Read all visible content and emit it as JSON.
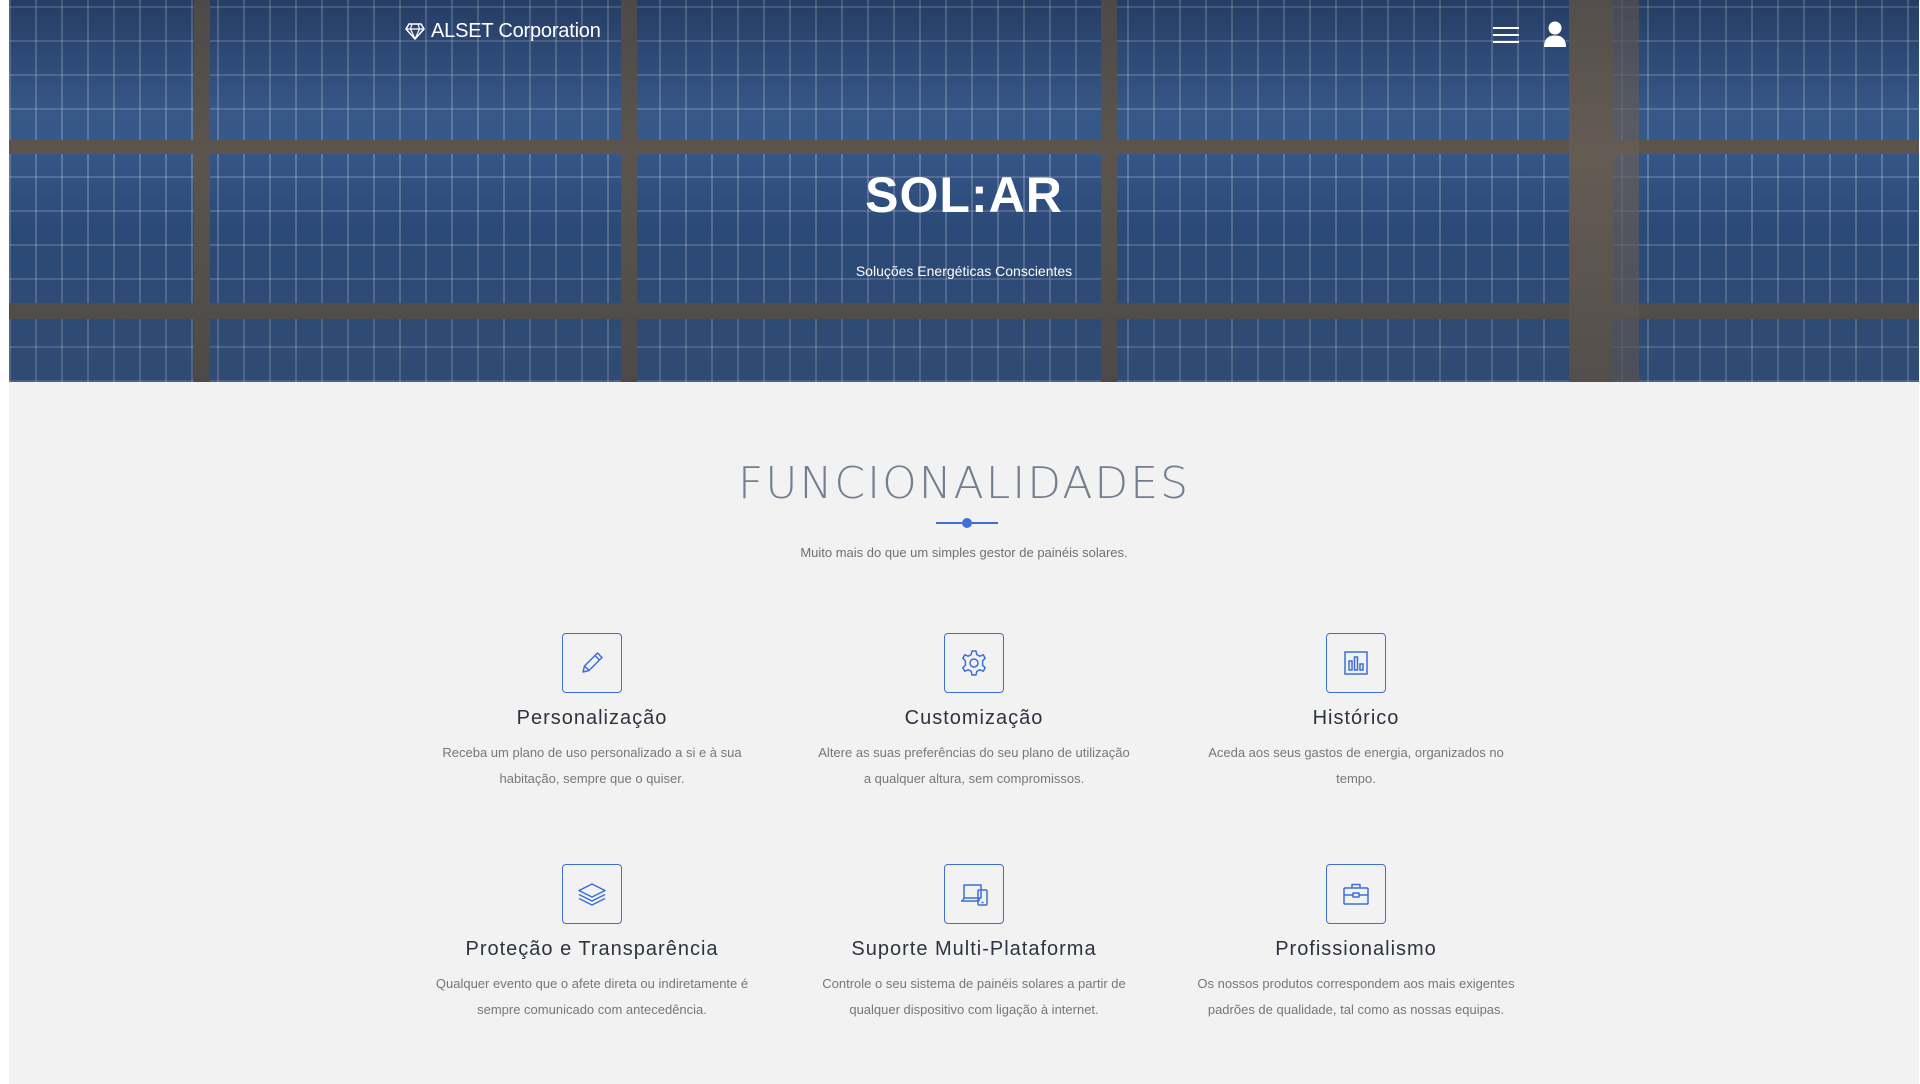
{
  "header": {
    "brand": "ALSET Corporation",
    "brand_icon": "diamond-icon",
    "menu_icon": "hamburger-menu-icon",
    "user_icon": "user-icon"
  },
  "hero": {
    "title": "SOL:AR",
    "subtitle": "Soluções Energéticas Conscientes"
  },
  "features_section": {
    "title": "FUNCIONALIDADES",
    "subtitle": "Muito mais do que um simples gestor de painéis solares.",
    "accent_color": "#3d6fd6",
    "items": [
      {
        "icon": "pencil-icon",
        "title": "Personalização",
        "description": "Receba um plano de uso personalizado a si e à sua habitação, sempre que o quiser."
      },
      {
        "icon": "gear-icon",
        "title": "Customização",
        "description": "Altere as suas preferências do seu plano de utilização a qualquer altura, sem compromissos."
      },
      {
        "icon": "bar-chart-icon",
        "title": "Histórico",
        "description": "Aceda aos seus gastos de energia, organizados no tempo."
      },
      {
        "icon": "layers-icon",
        "title": "Proteção e Transparência",
        "description": "Qualquer evento que o afete direta ou indiretamente é sempre comunicado com antecedência."
      },
      {
        "icon": "devices-icon",
        "title": "Suporte Multi-Plataforma",
        "description": "Controle o seu sistema de painéis solares a partir de qualquer dispositivo com ligação à internet."
      },
      {
        "icon": "briefcase-icon",
        "title": "Profissionalismo",
        "description": "Os nossos produtos correspondem aos mais exigentes padrões de qualidade, tal como as nossas equipas."
      }
    ]
  }
}
